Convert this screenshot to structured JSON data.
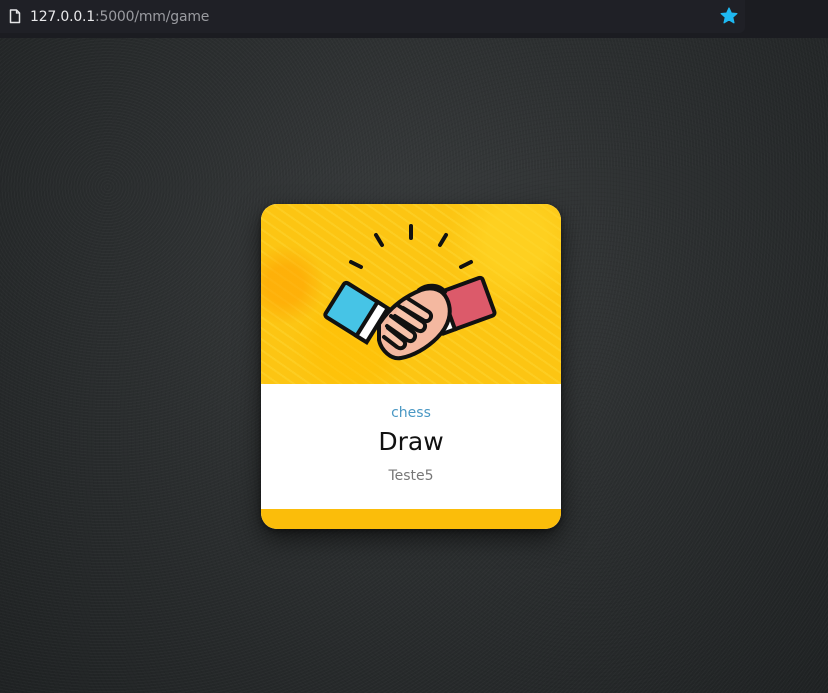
{
  "browser": {
    "url_host": "127.0.0.1",
    "url_path": ":5000/mm/game",
    "page_icon": "page-icon",
    "bookmark_icon": "star-icon",
    "bookmark_color": "#1fb8f0"
  },
  "card": {
    "image_icon": "handshake-icon",
    "game": "chess",
    "result": "Draw",
    "opponent": "Teste5",
    "accent_color": "#fbbd0a",
    "game_color": "#4a98c4"
  }
}
